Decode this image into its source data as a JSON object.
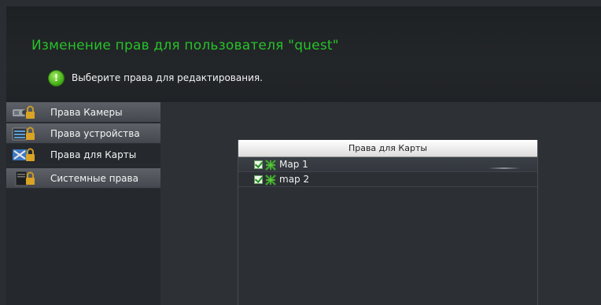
{
  "header": {
    "title": "Изменение прав для пользователя \"quest\"",
    "hint_icon_glyph": "!",
    "hint_text": "Выберите права для редактирования."
  },
  "sidebar": {
    "items": [
      {
        "label": "Права Камеры",
        "icon": "camera-lock-icon",
        "active": false
      },
      {
        "label": "Права устройства",
        "icon": "device-lock-icon",
        "active": false
      },
      {
        "label": "Права для Карты",
        "icon": "map-lock-icon",
        "active": true
      },
      {
        "label": "Системные права",
        "icon": "system-lock-icon",
        "active": false
      }
    ]
  },
  "panel": {
    "header": "Права для Карты",
    "rows": [
      {
        "label": "Map 1",
        "checked": true,
        "icon": "map-icon"
      },
      {
        "label": "map 2",
        "checked": true,
        "icon": "map-icon"
      }
    ]
  },
  "colors": {
    "title": "#27c229",
    "accent_green": "#3ea912",
    "background": "#2b2f34"
  }
}
